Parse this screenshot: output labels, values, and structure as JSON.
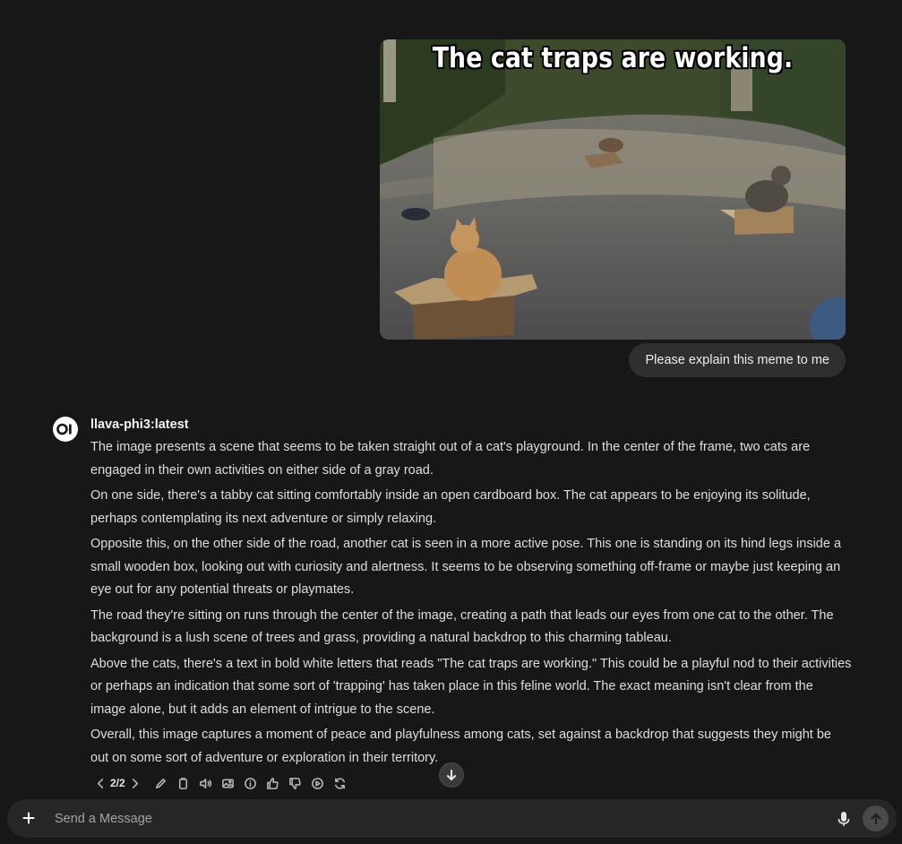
{
  "user_message": {
    "image_caption": "The cat traps are working.",
    "text": "Please explain this meme to me"
  },
  "assistant_message": {
    "model_name": "llava-phi3:latest",
    "paragraphs": [
      "The image presents a scene that seems to be taken straight out of a cat's playground. In the center of the frame, two cats are engaged in their own activities on either side of a gray road.",
      "On one side, there's a tabby cat sitting comfortably inside an open cardboard box. The cat appears to be enjoying its solitude, perhaps contemplating its next adventure or simply relaxing.",
      "Opposite this, on the other side of the road, another cat is seen in a more active pose. This one is standing on its hind legs inside a small wooden box, looking out with curiosity and alertness. It seems to be observing something off-frame or maybe just keeping an eye out for any potential threats or playmates.",
      "The road they're sitting on runs through the center of the image, creating a path that leads our eyes from one cat to the other. The background is a lush scene of trees and grass, providing a natural backdrop to this charming tableau.",
      "Above the cats, there's a text in bold white letters that reads \"The cat traps are working.\" This could be a playful nod to their activities or perhaps an indication that some sort of 'trapping' has taken place in this feline world. The exact meaning isn't clear from the image alone, but it adds an element of intrigue to the scene.",
      "Overall, this image captures a moment of peace and playfulness among cats, set against a backdrop that suggests they might be out on some sort of adventure or exploration in their territory."
    ],
    "pager": "2/2",
    "action_icons": [
      "edit-icon",
      "copy-icon",
      "speaker-icon",
      "image-icon",
      "info-icon",
      "thumbs-up-icon",
      "thumbs-down-icon",
      "play-icon",
      "regenerate-icon"
    ]
  },
  "composer": {
    "placeholder": "Send a Message"
  },
  "colors": {
    "background": "#171717",
    "bubble": "#2f2f2f",
    "composer": "#262626"
  }
}
